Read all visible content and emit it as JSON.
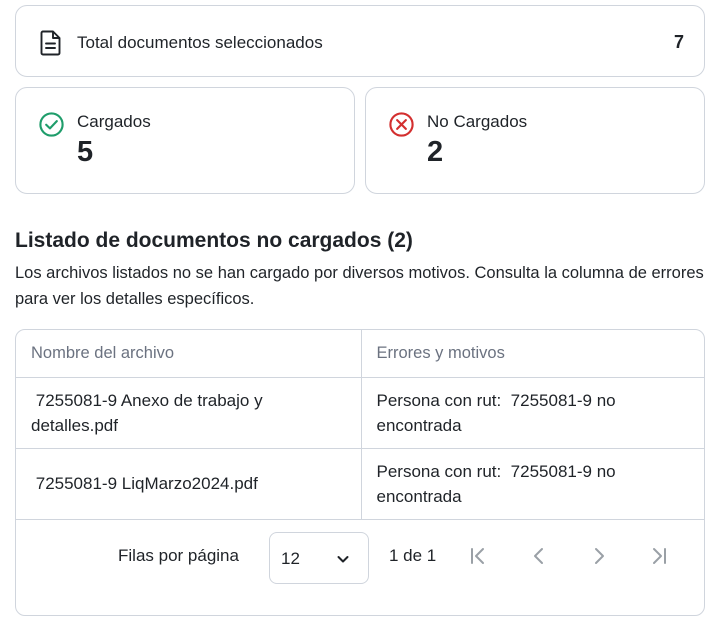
{
  "summary": {
    "total_label": "Total documentos seleccionados",
    "total_count": "7",
    "loaded_label": "Cargados",
    "loaded_count": "5",
    "not_loaded_label": "No Cargados",
    "not_loaded_count": "2"
  },
  "section": {
    "title": "Listado de documentos no cargados (2)",
    "description": "Los archivos listados no se han cargado por diversos motivos. Consulta la columna de errores para ver los detalles específicos."
  },
  "table": {
    "columns": [
      "Nombre del archivo",
      "Errores y motivos"
    ],
    "rows": [
      {
        "file": " 7255081-9 Anexo de trabajo y detalles.pdf",
        "error": "Persona con rut:  7255081-9 no encontrada"
      },
      {
        "file": " 7255081-9 LiqMarzo2024.pdf",
        "error": "Persona con rut:  7255081-9 no encontrada"
      }
    ]
  },
  "pagination": {
    "rows_per_page_label": "Filas por página",
    "rows_per_page_value": "12",
    "range_label": "1 de 1"
  },
  "colors": {
    "success": "#1f9d6b",
    "error": "#d32f2f",
    "border": "#d0d5dd",
    "muted_text": "#6b7280",
    "nav_icon": "#9aa0a6"
  },
  "icons": {
    "total": "document-icon",
    "loaded": "check-circle-icon",
    "not_loaded": "x-circle-icon",
    "select": "chevron-down-icon",
    "first": "first-page-icon",
    "prev": "chevron-left-icon",
    "next": "chevron-right-icon",
    "last": "last-page-icon"
  }
}
